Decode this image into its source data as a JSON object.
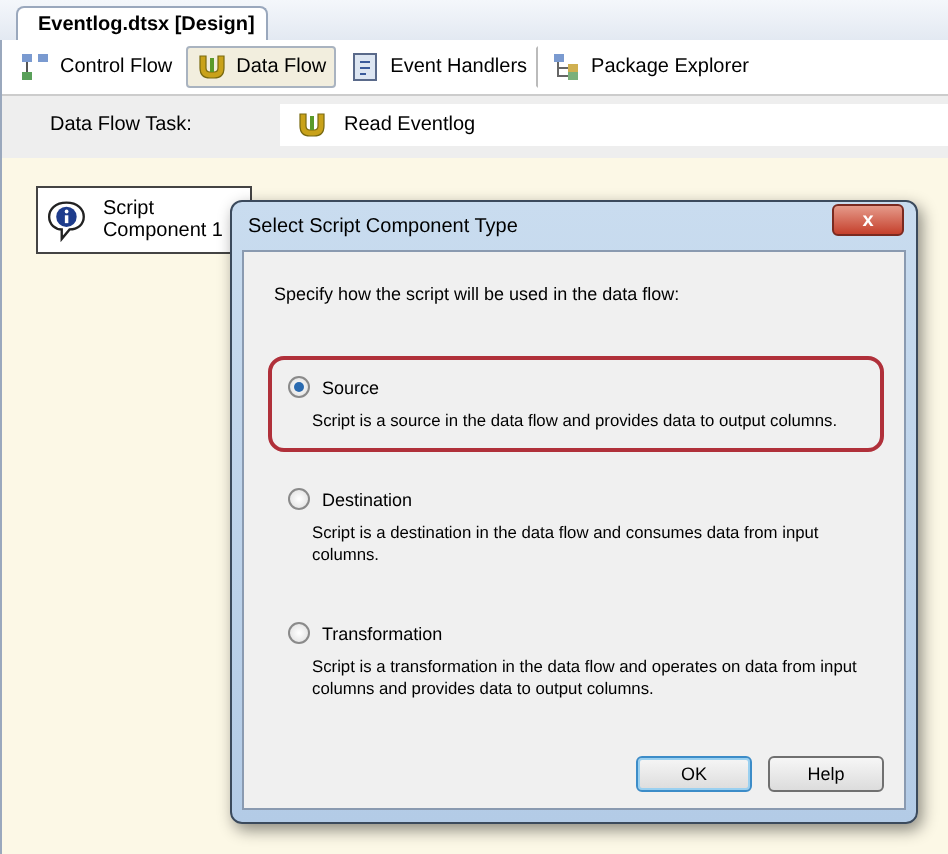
{
  "document_tab": {
    "title": "Eventlog.dtsx [Design]"
  },
  "designer_tabs": [
    {
      "label": "Control Flow",
      "kind": "control",
      "selected": false
    },
    {
      "label": "Data Flow",
      "kind": "dataflow",
      "selected": true
    },
    {
      "label": "Event Handlers",
      "kind": "events",
      "selected": false
    },
    {
      "label": "Package Explorer",
      "kind": "explorer",
      "selected": false
    }
  ],
  "task_bar": {
    "label": "Data Flow Task:",
    "value": "Read Eventlog"
  },
  "canvas": {
    "components": [
      {
        "label": "Script Component 1"
      }
    ]
  },
  "dialog": {
    "title": "Select Script Component Type",
    "close": "x",
    "prompt": "Specify how the script will be used in the data flow:",
    "options": [
      {
        "label": "Source",
        "description": "Script is a source in the data flow and provides data to output columns.",
        "selected": true,
        "highlighted": true
      },
      {
        "label": "Destination",
        "description": "Script is a destination in the data flow and consumes data from input columns.",
        "selected": false,
        "highlighted": false
      },
      {
        "label": "Transformation",
        "description": "Script is a transformation in the data flow and operates on data from input columns and provides data to output columns.",
        "selected": false,
        "highlighted": false
      }
    ],
    "buttons": [
      {
        "label": "OK",
        "kind": "default"
      },
      {
        "label": "Help",
        "kind": "normal"
      }
    ]
  }
}
